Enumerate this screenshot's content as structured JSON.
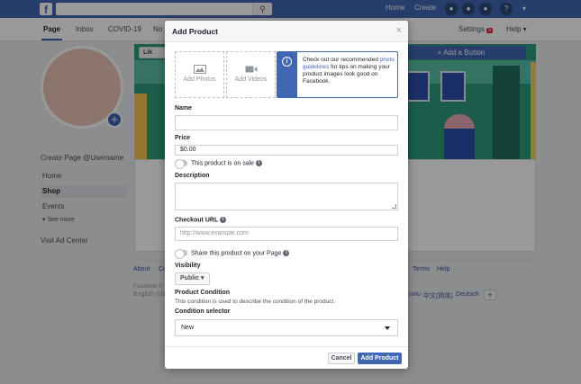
{
  "topbar": {
    "logo": "f",
    "search_icon": "search-icon",
    "nav": [
      "Home",
      "Create"
    ],
    "icons": [
      "friends-icon",
      "messenger-icon",
      "notifications-icon",
      "help-icon",
      "account-menu-icon"
    ]
  },
  "pagenav": {
    "tabs": [
      "Page",
      "Inbox",
      "COVID-19",
      "No"
    ],
    "settings": "Settings",
    "settings_badge": "5",
    "help": "Help ▾"
  },
  "sidebar": {
    "handle": "Create Page @Username",
    "items": [
      "Home",
      "Shop",
      "Events"
    ],
    "see_more": "See more",
    "visit_ad": "Visit Ad Center"
  },
  "cover": {
    "like": "Lik",
    "add_button": "+ Add a Button"
  },
  "footer": {
    "links": [
      "About",
      "Cr",
      "Terms",
      "Help"
    ],
    "copyright": "Facebook ©",
    "lang_left": "English (US",
    "lang_right": [
      "uviu",
      "中文(简体)",
      "Deutsch"
    ],
    "plus": "+"
  },
  "modal": {
    "title": "Add Product",
    "close": "×",
    "add_photos": "Add Photos",
    "add_videos": "Add Videos",
    "info": {
      "pre": "Check out our recommended ",
      "link": "photo guidelines",
      "post": " for tips on making your product images look good on Facebook.",
      "icon": "i"
    },
    "name_label": "Name",
    "name_value": "",
    "price_label": "Price",
    "price_value": "$0.00",
    "sale_label": "This product is on sale",
    "description_label": "Description",
    "description_value": "",
    "checkout_label": "Checkout URL",
    "checkout_placeholder": "http://www.example.com",
    "share_label": "Share this product on your Page",
    "visibility_label": "Visibility",
    "visibility_value": "Public ▾",
    "condition_label": "Product Condition",
    "condition_help": "This condition is used to describe the condition of the product.",
    "condition_selector_label": "Condition selector",
    "condition_value": "New",
    "cancel": "Cancel",
    "add_product": "Add Product",
    "hint_glyph": "i"
  },
  "colors": {
    "brand": "#4267b2",
    "overlay": "rgba(0,0,0,0.4)"
  }
}
